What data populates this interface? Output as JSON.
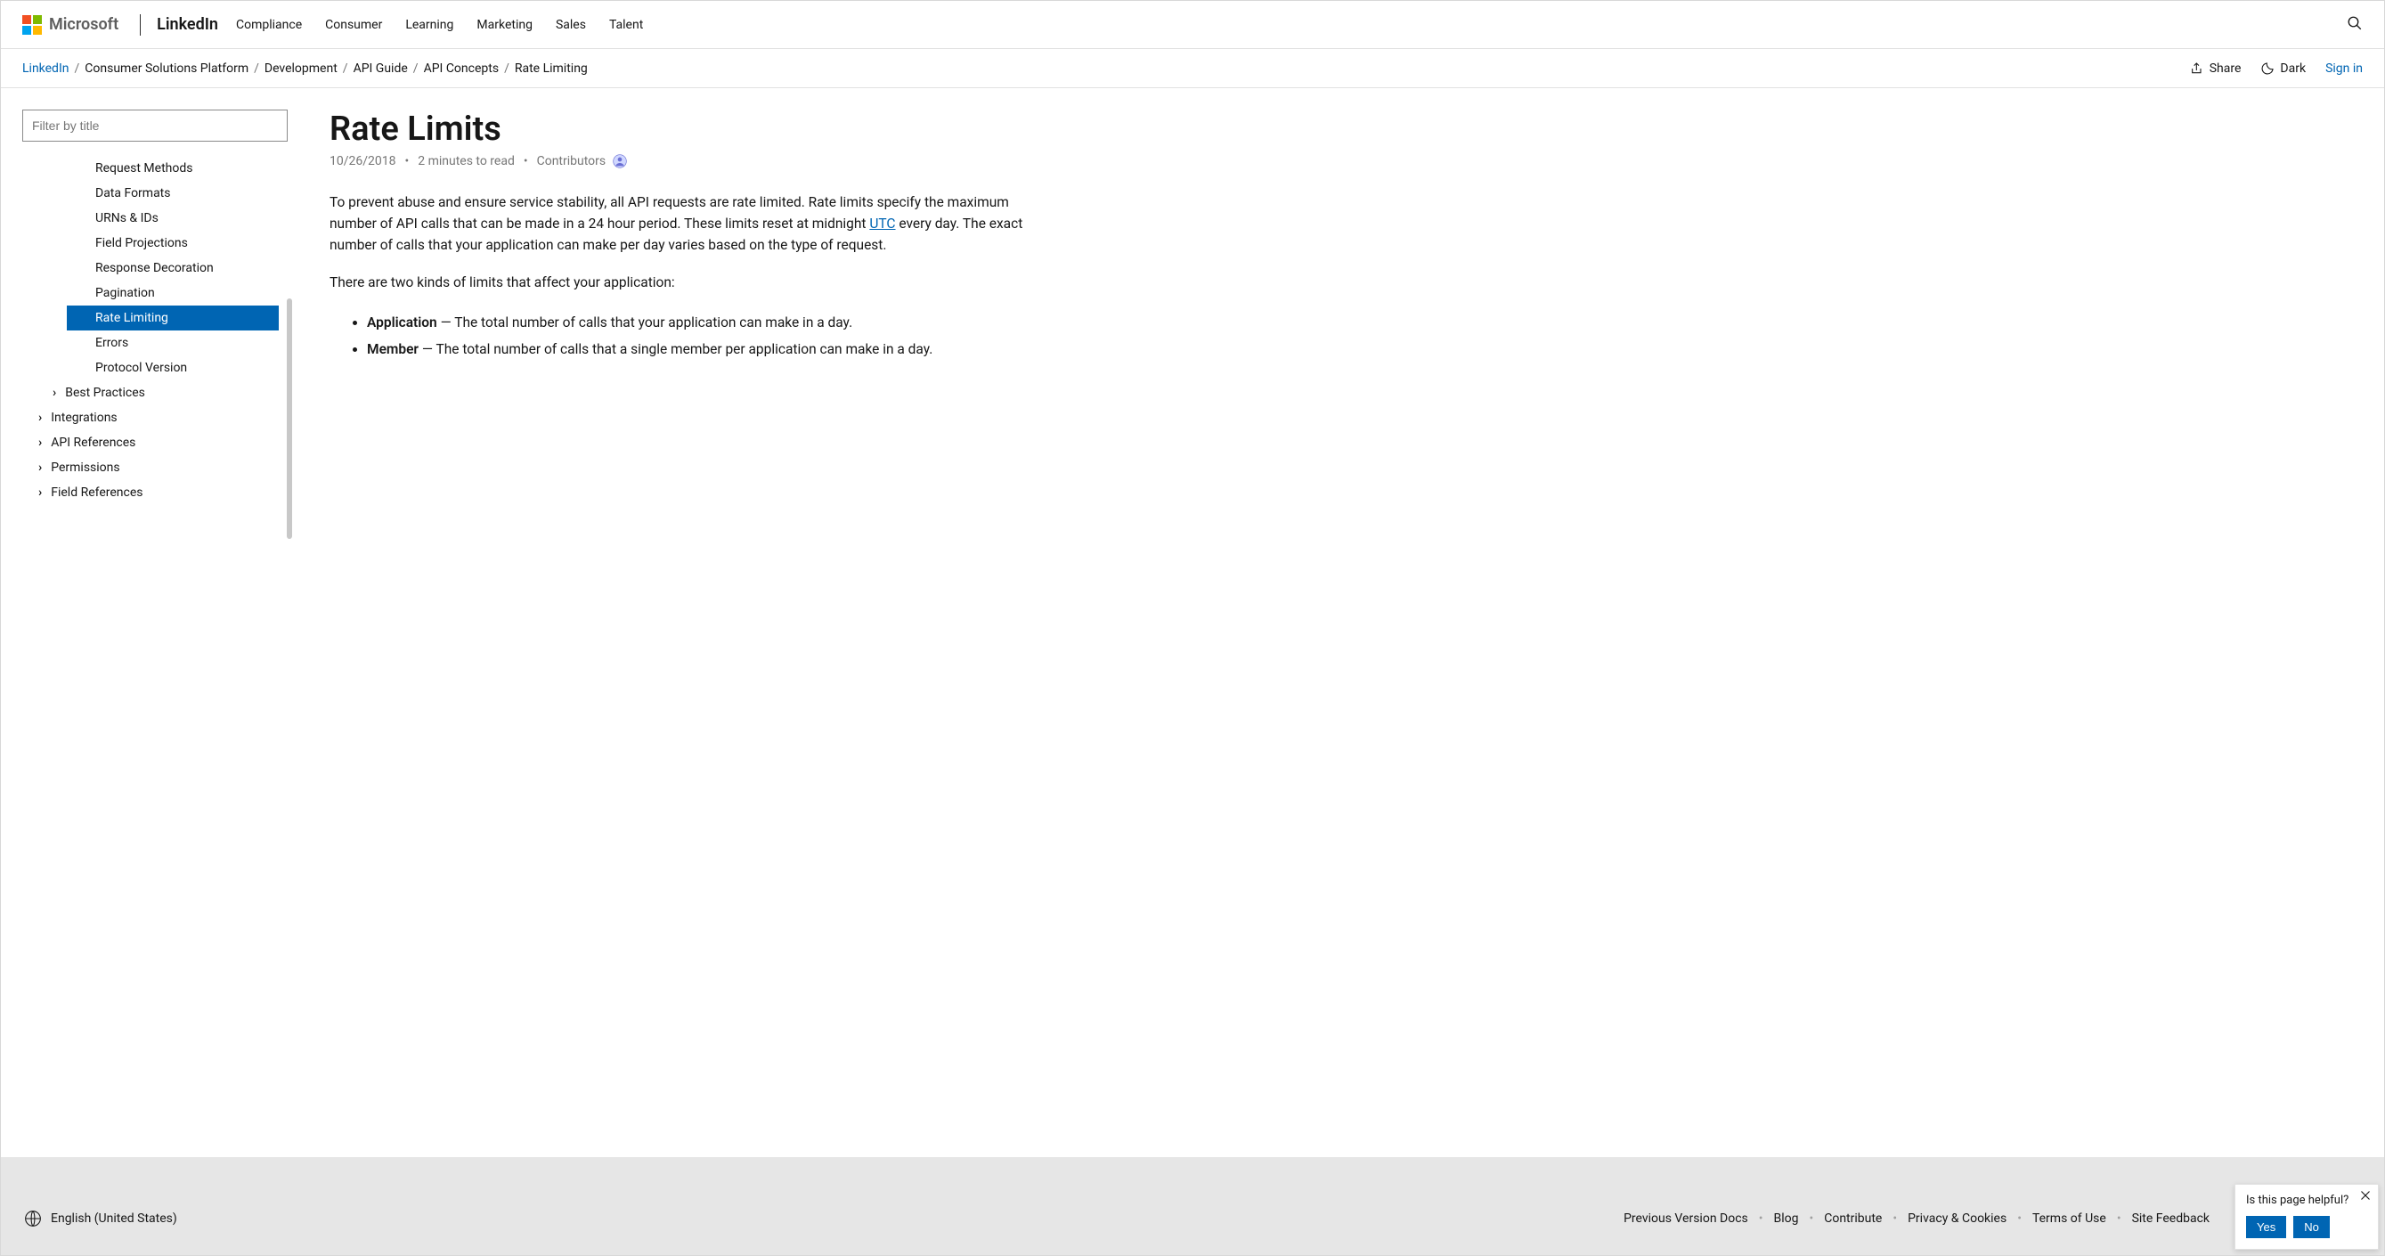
{
  "header": {
    "brand": "Microsoft",
    "product": "LinkedIn",
    "nav": [
      "Compliance",
      "Consumer",
      "Learning",
      "Marketing",
      "Sales",
      "Talent"
    ]
  },
  "breadcrumb": {
    "root": "LinkedIn",
    "items": [
      "Consumer Solutions Platform",
      "Development",
      "API Guide",
      "API Concepts",
      "Rate Limiting"
    ]
  },
  "actions": {
    "share": "Share",
    "theme": "Dark",
    "signin": "Sign in"
  },
  "sidebar": {
    "filter_placeholder": "Filter by title",
    "items": [
      {
        "label": "Request Methods",
        "level": 2
      },
      {
        "label": "Data Formats",
        "level": 2
      },
      {
        "label": "URNs & IDs",
        "level": 2
      },
      {
        "label": "Field Projections",
        "level": 2
      },
      {
        "label": "Response Decoration",
        "level": 2
      },
      {
        "label": "Pagination",
        "level": 2
      },
      {
        "label": "Rate Limiting",
        "level": 2,
        "active": true
      },
      {
        "label": "Errors",
        "level": 2
      },
      {
        "label": "Protocol Version",
        "level": 2
      },
      {
        "label": "Best Practices",
        "level": 1,
        "expandable": true
      },
      {
        "label": "Integrations",
        "level": 0,
        "expandable": true
      },
      {
        "label": "API References",
        "level": 0,
        "expandable": true
      },
      {
        "label": "Permissions",
        "level": 0,
        "expandable": true
      },
      {
        "label": "Field References",
        "level": 0,
        "expandable": true
      }
    ]
  },
  "article": {
    "title": "Rate Limits",
    "date": "10/26/2018",
    "read_time": "2 minutes to read",
    "contributors_label": "Contributors",
    "p1_a": "To prevent abuse and ensure service stability, all API requests are rate limited. Rate limits specify the maximum number of API calls that can be made in a 24 hour period. These limits reset at midnight ",
    "utc": "UTC",
    "p1_b": " every day. The exact number of calls that your application can make per day varies based on the type of request.",
    "p2": "There are two kinds of limits that affect your application:",
    "li1_b": "Application",
    "li1_t": " — The total number of calls that your application can make in a day.",
    "li2_b": "Member",
    "li2_t": " — The total number of calls that a single member per application can make in a day."
  },
  "footer": {
    "locale": "English (United States)",
    "links": [
      "Previous Version Docs",
      "Blog",
      "Contribute",
      "Privacy & Cookies",
      "Terms of Use",
      "Site Feedback"
    ]
  },
  "feedback": {
    "prompt": "Is this page helpful?",
    "yes": "Yes",
    "no": "No"
  }
}
